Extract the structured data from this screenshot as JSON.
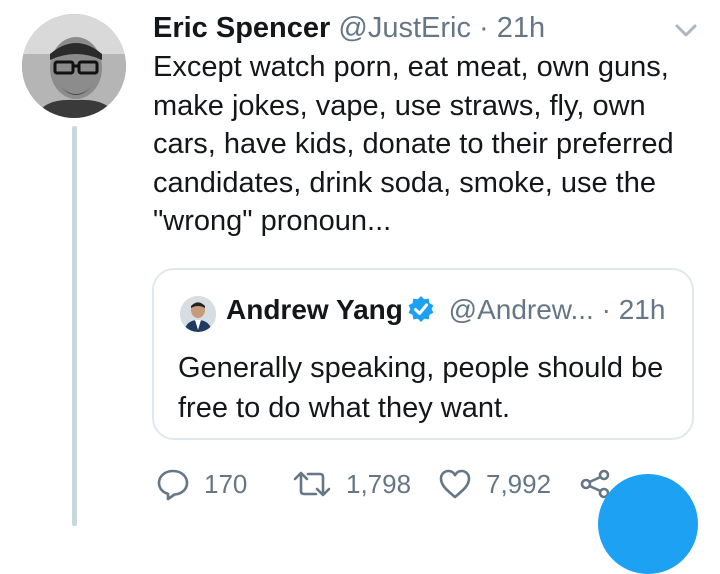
{
  "tweet": {
    "author_name": "Eric Spencer",
    "author_handle": "@JustEric",
    "separator": "·",
    "time": "21h",
    "text_lines": [
      "Except watch porn, eat meat, own guns,",
      "make jokes, vape, use straws, fly, own",
      "cars, have kids, donate to their preferred",
      "candidates, drink soda, smoke, use the",
      "\"wrong\" pronoun..."
    ]
  },
  "quoted_tweet": {
    "author_name": "Andrew Yang",
    "author_handle": "@Andrew...",
    "separator": "·",
    "time": "21h",
    "text_lines": [
      "Generally speaking, people should be",
      "free to do what they want."
    ]
  },
  "actions": {
    "reply_count": "170",
    "retweet_count": "1,798",
    "like_count": "7,992"
  },
  "icons": {
    "chevron": "chevron-down-icon",
    "verified": "verified-badge-icon",
    "reply": "reply-icon",
    "retweet": "retweet-icon",
    "like": "heart-icon",
    "share": "share-icon"
  },
  "colors": {
    "text": "#14171a",
    "secondary": "#657786",
    "accent": "#1da1f2",
    "border": "#e1e8ed",
    "thread_line": "#ccd6dd"
  }
}
